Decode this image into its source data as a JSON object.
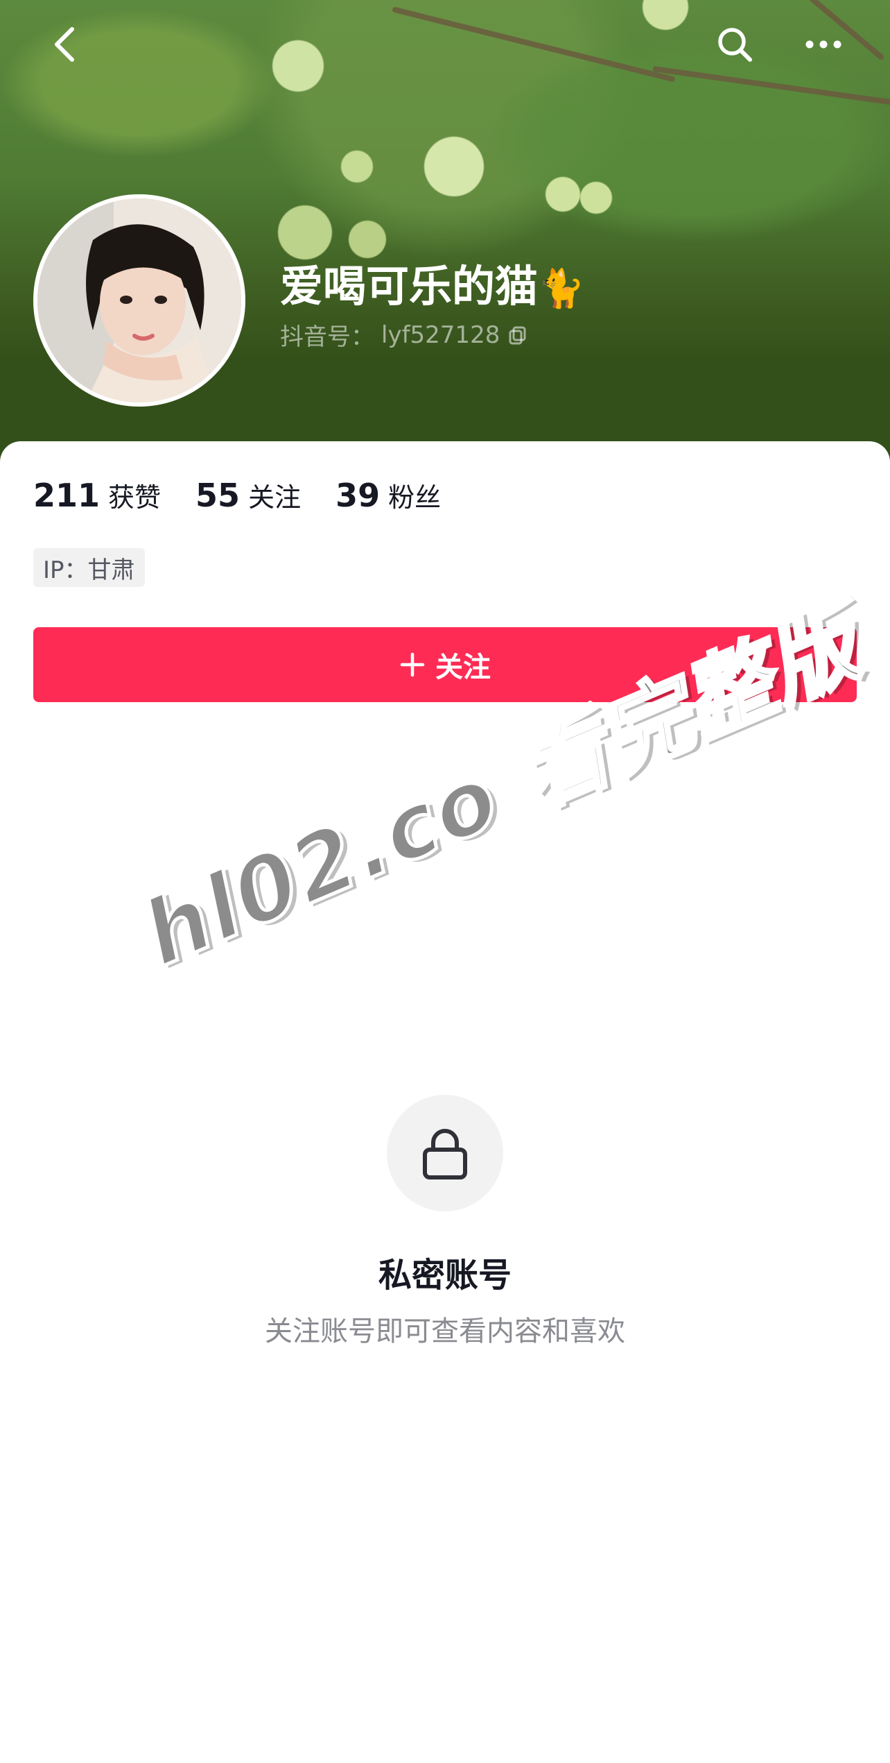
{
  "header": {
    "back_icon": "chevron-left-icon",
    "search_icon": "search-icon",
    "more_icon": "more-dots-icon"
  },
  "profile": {
    "name": "爱喝可乐的猫",
    "name_emoji": "🐈",
    "id_label": "抖音号：",
    "id_value": "lyf527128",
    "copy_icon": "copy-icon"
  },
  "stats": [
    {
      "value": "211",
      "label": "获赞"
    },
    {
      "value": "55",
      "label": "关注"
    },
    {
      "value": "39",
      "label": "粉丝"
    }
  ],
  "ip_tag": "IP：甘肃",
  "follow_button": {
    "label": "关注",
    "icon": "plus-icon",
    "color": "#fe2c55"
  },
  "private_notice": {
    "icon": "lock-icon",
    "title": "私密账号",
    "subtitle": "关注账号即可查看内容和喜欢"
  },
  "watermark": "hl02.co 看完整版"
}
